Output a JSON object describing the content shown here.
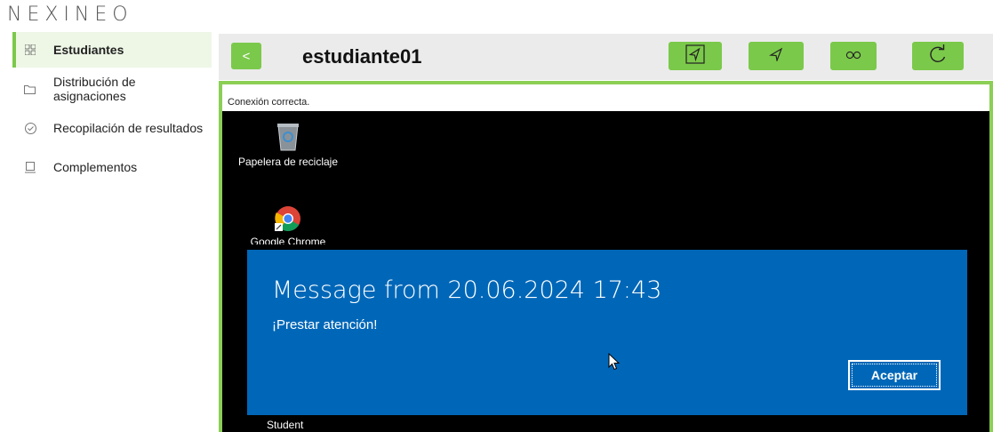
{
  "app": {
    "logo": "NEXINEO"
  },
  "sidebar": {
    "items": [
      {
        "label": "Estudiantes",
        "icon": "grid-icon",
        "active": true
      },
      {
        "label": "Distribución de asignaciones",
        "icon": "folder-icon",
        "active": false
      },
      {
        "label": "Recopilación de resultados",
        "icon": "check-circle-icon",
        "active": false
      },
      {
        "label": "Complementos",
        "icon": "laptop-icon",
        "active": false
      }
    ]
  },
  "header": {
    "back_label": "<",
    "title": "estudiante01",
    "toolbar_icons": [
      "send-box-icon",
      "send-icon",
      "infinity-icon",
      "refresh-icon"
    ]
  },
  "remote": {
    "status": "Conexión correcta.",
    "desktop_icons": [
      {
        "label": "Papelera de reciclaje",
        "icon": "recycle-bin-icon"
      },
      {
        "label": "Google Chrome",
        "icon": "chrome-icon"
      }
    ],
    "dialog": {
      "title": "Message from  20.06.2024 17:43",
      "message": "¡Prestar atención!",
      "button": "Aceptar"
    },
    "bottom_label": "Student"
  },
  "colors": {
    "accent": "#7bc94a",
    "dialog": "#0067b8",
    "topbar": "#ebebeb"
  }
}
